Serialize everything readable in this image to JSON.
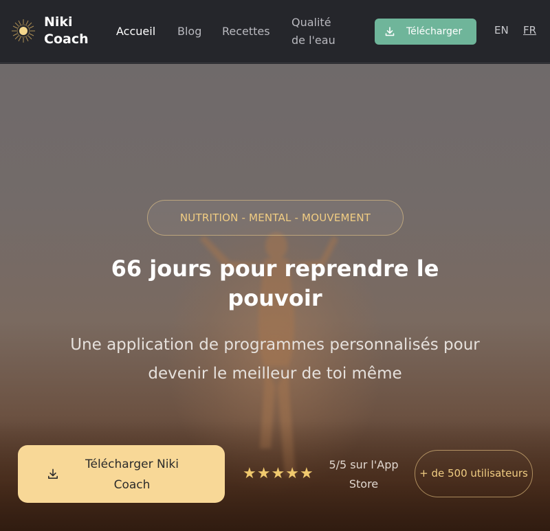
{
  "brand": {
    "name": "Niki Coach",
    "logo_icon": "sun-logo-icon"
  },
  "nav": {
    "items": [
      {
        "label": "Accueil",
        "active": true
      },
      {
        "label": "Blog",
        "active": false
      },
      {
        "label": "Recettes",
        "active": false
      },
      {
        "label": "Qualité de l'eau",
        "active": false
      }
    ],
    "download_label": "Télécharger",
    "download_icon": "download-icon",
    "languages": [
      "EN",
      "FR"
    ],
    "active_language": "FR"
  },
  "hero": {
    "tagline": "NUTRITION - MENTAL - MOUVEMENT",
    "title": "66 jours pour reprendre le pouvoir",
    "subtitle": "Une application de programmes personnalisés pour devenir le meilleur de toi même",
    "cta_label": "Télécharger Niki Coach",
    "cta_icon": "download-icon",
    "rating_stars": 5,
    "rating_text": "5/5 sur l'App Store",
    "users_text": "+ de 500 utilisateurs"
  },
  "colors": {
    "navbar_bg": "#25262b",
    "accent_green": "#6fb59a",
    "accent_gold": "#f1cd83",
    "cta_bg": "#f8d897"
  }
}
